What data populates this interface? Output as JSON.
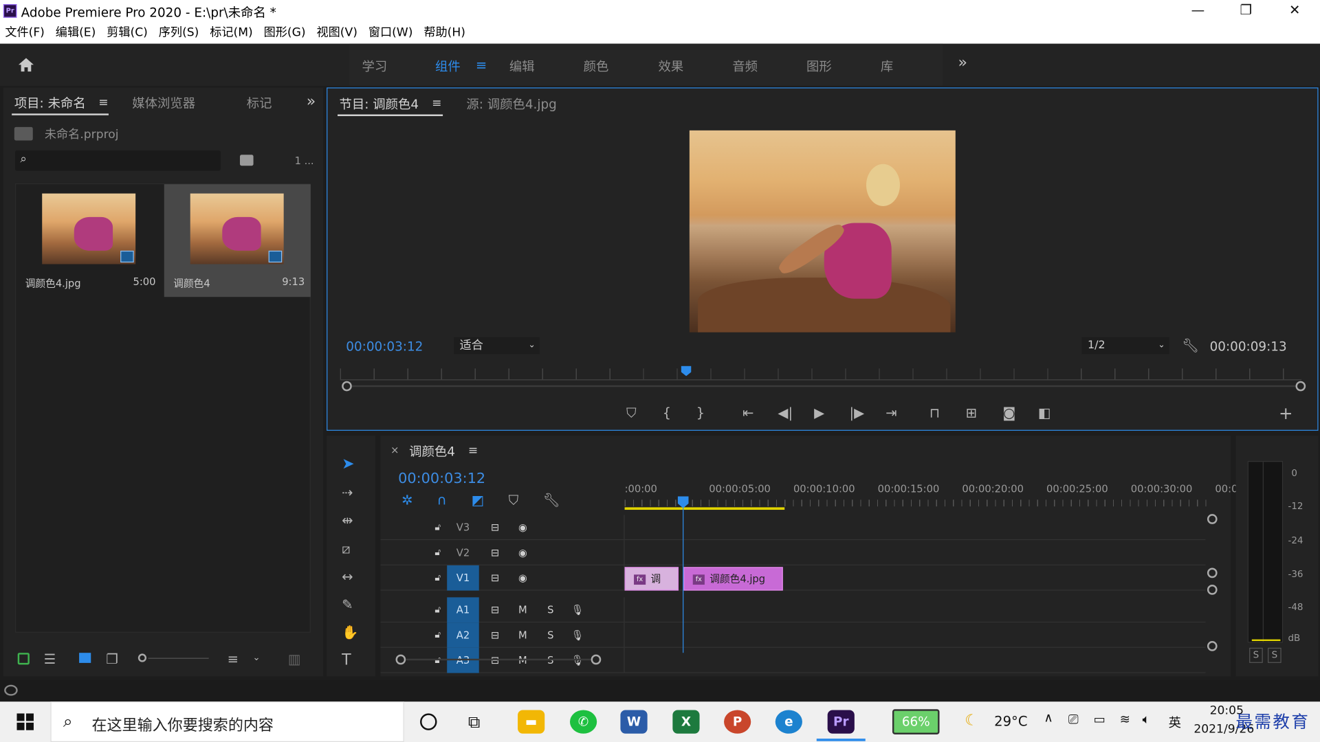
{
  "app": {
    "icon": "Pr",
    "title": "Adobe Premiere Pro 2020 - E:\\pr\\未命名 *",
    "minimize": "—",
    "restore": "❐",
    "close": "✕"
  },
  "menu": [
    "文件(F)",
    "编辑(E)",
    "剪辑(C)",
    "序列(S)",
    "标记(M)",
    "图形(G)",
    "视图(V)",
    "窗口(W)",
    "帮助(H)"
  ],
  "workspaces": {
    "items": [
      "学习",
      "组件",
      "编辑",
      "颜色",
      "效果",
      "音频",
      "图形",
      "库"
    ],
    "active": "组件",
    "more": "»"
  },
  "project": {
    "tabs": [
      "项目: 未命名",
      "媒体浏览器",
      "标记"
    ],
    "more": "»",
    "file": "未命名.prproj",
    "count": "1 ...",
    "search_placeholder": "",
    "items": [
      {
        "name": "调颜色4.jpg",
        "duration": "5:00"
      },
      {
        "name": "调颜色4",
        "duration": "9:13"
      }
    ]
  },
  "program": {
    "tabs": [
      "节目: 调颜色4",
      "源: 调颜色4.jpg"
    ],
    "timecode": "00:00:03:12",
    "fit": "适合",
    "quality": "1/2",
    "duration": "00:00:09:13",
    "playhead_fraction": 0.36
  },
  "timeline": {
    "sequence": "调颜色4",
    "timecode": "00:00:03:12",
    "ruler": [
      ":00:00",
      "00:00:05:00",
      "00:00:10:00",
      "00:00:15:00",
      "00:00:20:00",
      "00:00:25:00",
      "00:00:30:00",
      "00:0("
    ],
    "video_tracks": [
      "V3",
      "V2",
      "V1"
    ],
    "audio_tracks": [
      "A1",
      "A2",
      "A3"
    ],
    "mute": "M",
    "solo": "S",
    "clips": [
      {
        "label": "调",
        "fx": "fx"
      },
      {
        "label": "调颜色4.jpg",
        "fx": "fx"
      }
    ]
  },
  "meter": {
    "scale": [
      "0",
      "-12",
      "-24",
      "-36",
      "-48",
      "dB"
    ],
    "solo": [
      "S",
      "S"
    ]
  },
  "taskbar": {
    "search": "在这里输入你要搜索的内容",
    "battery": "66%",
    "weather": "29°C",
    "ime": "英",
    "time": "20:05",
    "date": "2021/9/26",
    "watermark": "最需教育"
  },
  "colors": {
    "accent": "#2d8ceb",
    "clip": "#c86ad6",
    "track_active": "#1a5d98"
  }
}
